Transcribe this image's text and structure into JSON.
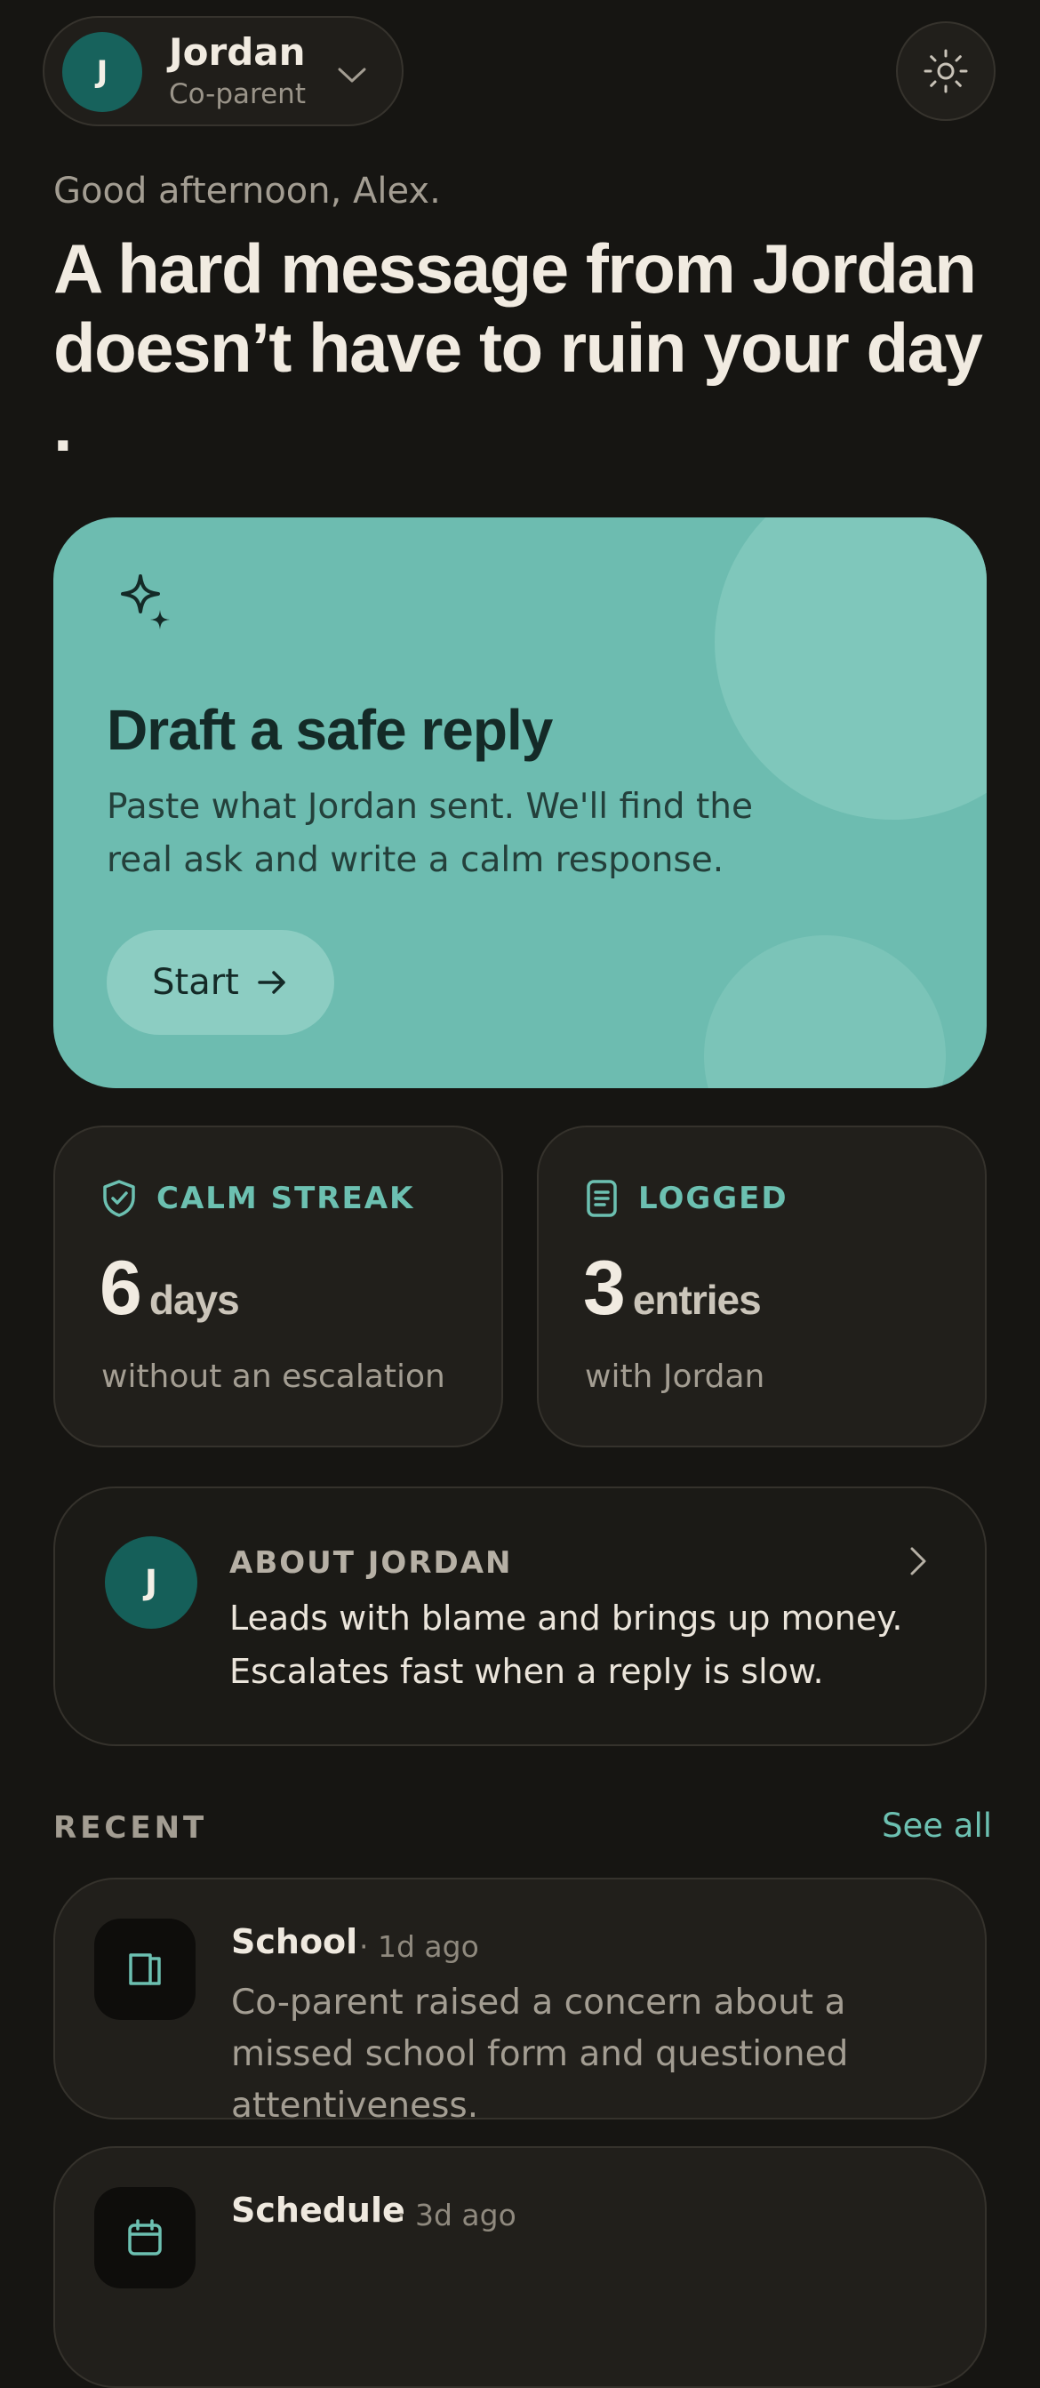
{
  "header": {
    "avatar_initial": "J",
    "name": "Jordan",
    "role": "Co-parent"
  },
  "greeting": "Good afternoon, Alex.",
  "headline": "A hard message from Jordan doesn’t have to ruin your day .",
  "hero": {
    "title": "Draft a safe reply",
    "description": "Paste what Jordan sent. We'll find the real ask and write a calm response.",
    "button_label": "Start"
  },
  "stats": [
    {
      "label": "CALM STREAK",
      "value": "6",
      "unit": "days",
      "sub": "without an escalation",
      "icon": "shield-check-icon"
    },
    {
      "label": "LOGGED",
      "value": "3",
      "unit": "entries",
      "sub": "with Jordan",
      "icon": "document-icon"
    }
  ],
  "about": {
    "avatar_initial": "J",
    "label": "ABOUT JORDAN",
    "text": "Leads with blame and brings up money. Escalates fast when a reply is slow."
  },
  "recent": {
    "label": "RECENT",
    "see_all": "See all",
    "items": [
      {
        "title": "School",
        "time": "· 1d ago",
        "description": "Co-parent raised a concern about a missed school form and questioned attentiveness.",
        "icon": "book-icon"
      },
      {
        "title": "Schedule",
        "time": "· 3d ago",
        "description": "",
        "icon": "calendar-icon"
      }
    ]
  },
  "colors": {
    "background": "#161512",
    "accent_teal": "#6cc0b1",
    "hero_card": "#6dbcb0",
    "avatar": "#17625c"
  }
}
